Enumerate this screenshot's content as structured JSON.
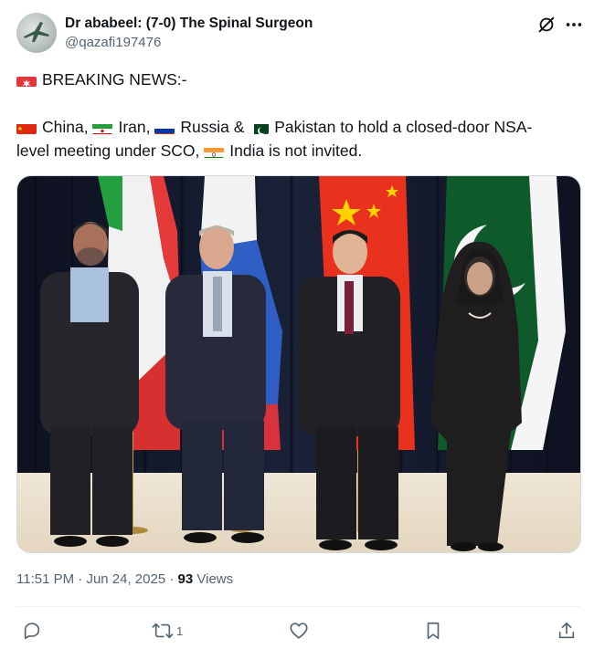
{
  "author": {
    "display_name": "Dr ababeel: (7-0) The Spinal Surgeon",
    "handle": "@qazafi197476"
  },
  "tweet": {
    "headline_emoji_icon": "siren-icon",
    "headline": "BREAKING NEWS:-",
    "line2_segments": [
      "China, ",
      "Iran, ",
      "Russia & ",
      "Pakistan to hold a closed-door NSA-"
    ],
    "line3_segments": [
      "level meeting under SCO, ",
      "India is not invited."
    ],
    "flags": [
      "flag-china-icon",
      "flag-iran-icon",
      "flag-russia-icon",
      "flag-pakistan-icon",
      "flag-india-icon"
    ]
  },
  "meta": {
    "time": "11:51 PM",
    "separator": " · ",
    "date": "Jun 24, 2025",
    "views_count": "93",
    "views_label": " Views"
  },
  "actions": {
    "retweet_count": "1"
  },
  "colors": {
    "text": "#0f1419",
    "secondary": "#536471",
    "border": "#cfd9de"
  }
}
